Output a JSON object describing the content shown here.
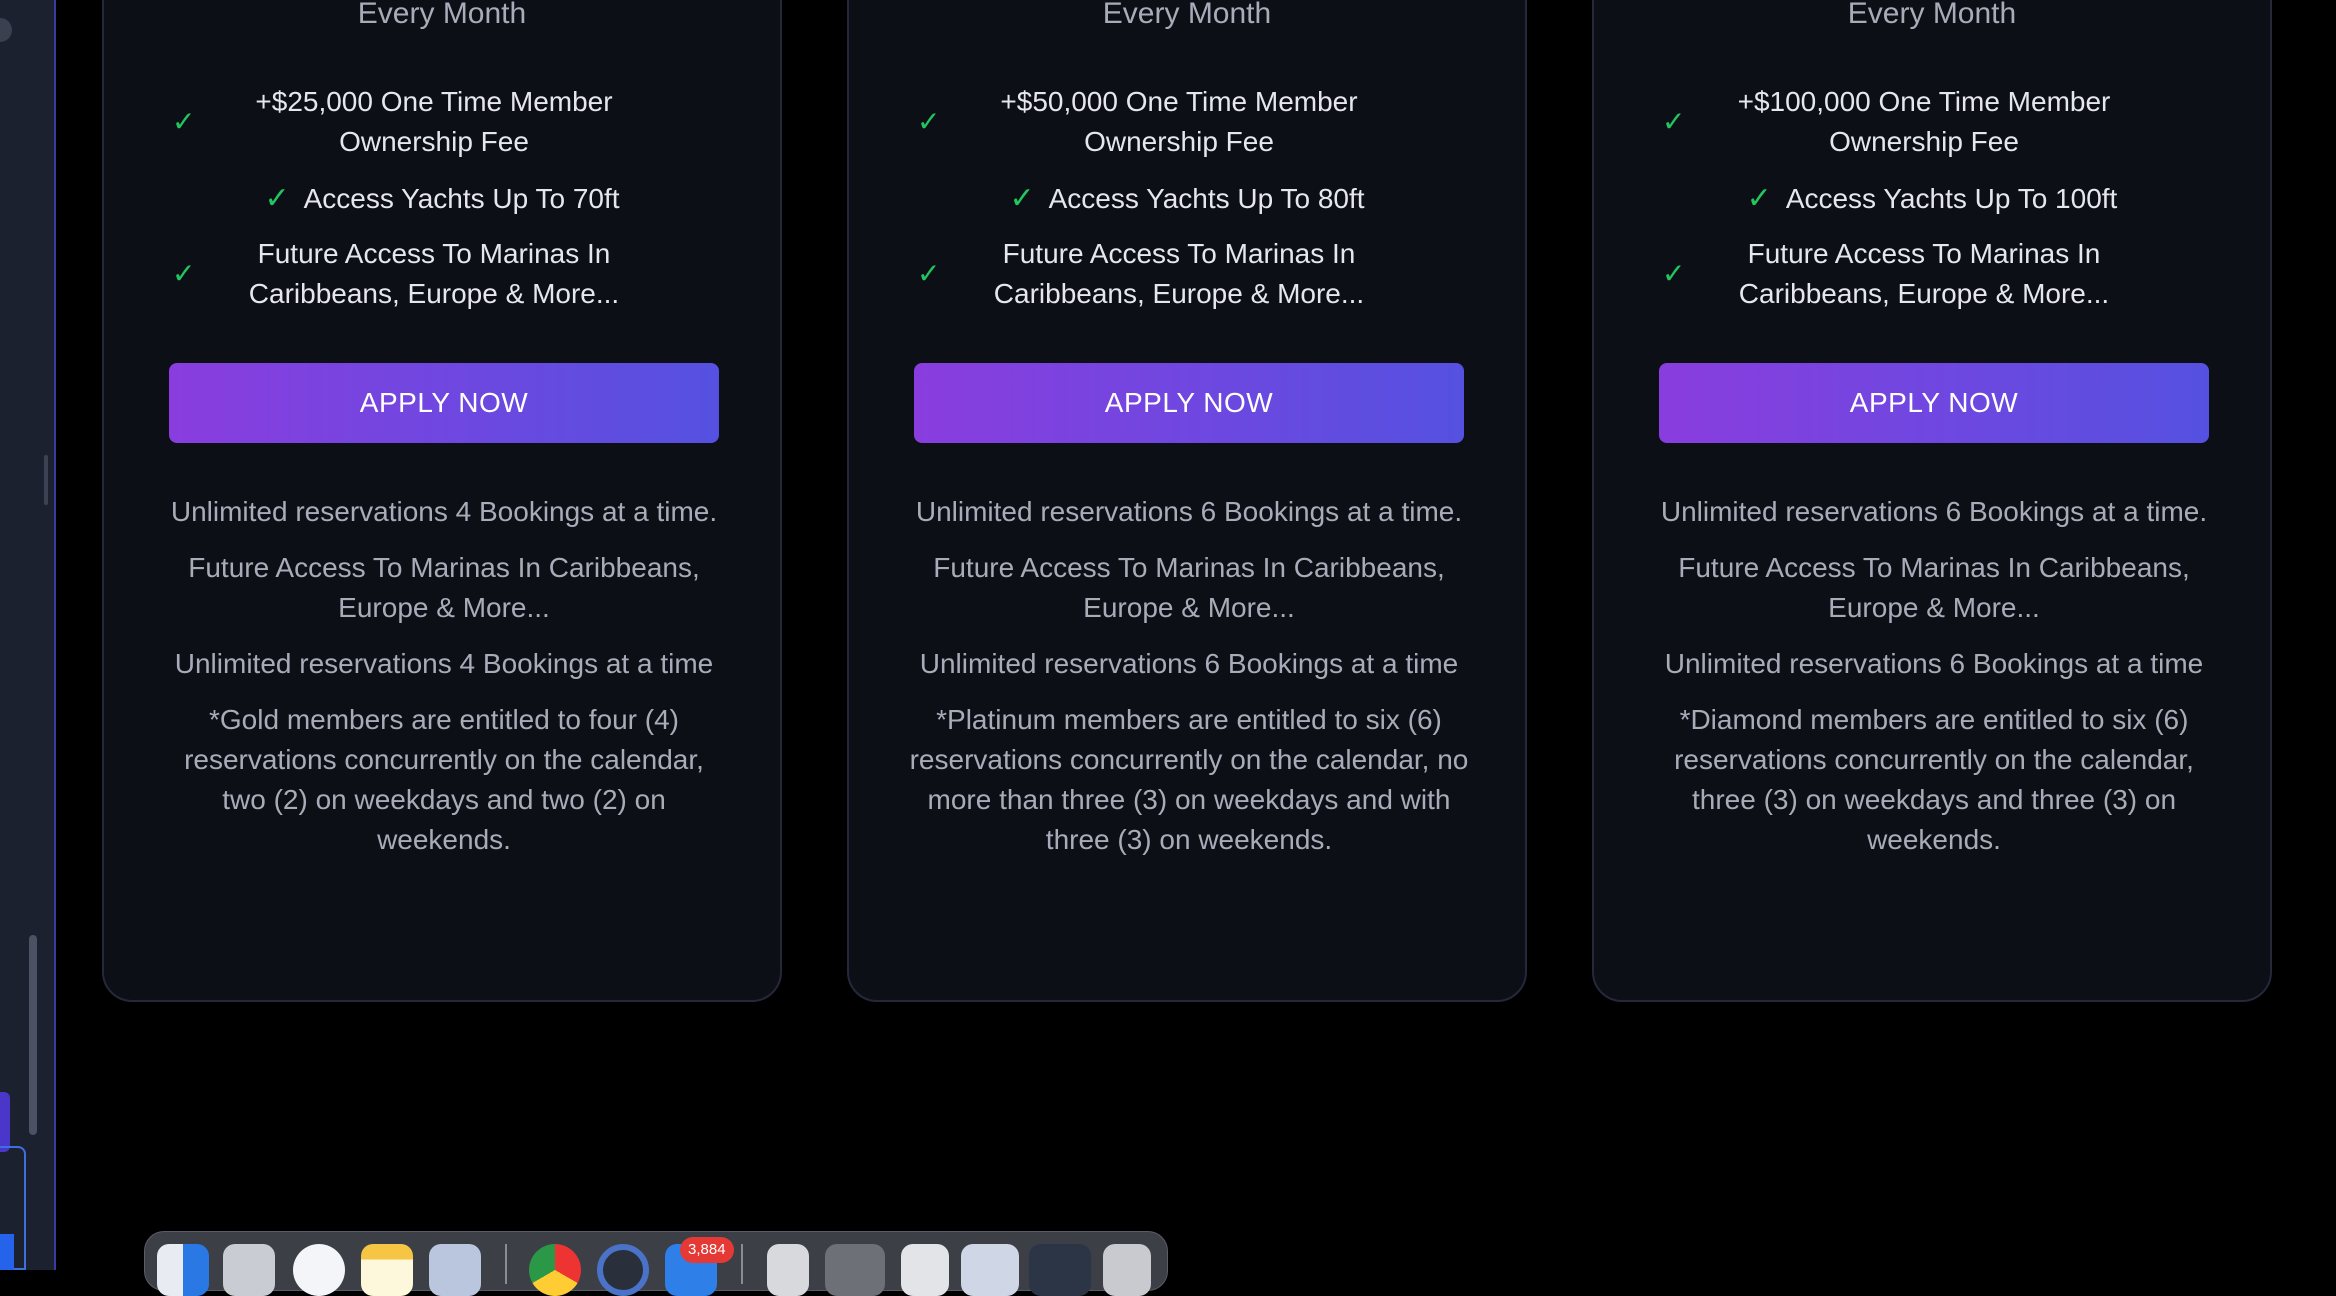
{
  "plans": [
    {
      "id": "gold",
      "period": "Every Month",
      "features": [
        "+$25,000 One Time Member Ownership Fee",
        "Access Yachts Up To 70ft",
        "Future Access To Marinas In Caribbeans, Europe & More..."
      ],
      "cta": "APPLY NOW",
      "notes": [
        "Unlimited reservations 4 Bookings at a time.",
        "Future Access To Marinas In Caribbeans, Europe & More...",
        "Unlimited reservations 4 Bookings at a time",
        "*Gold members are entitled to four (4) reservations concurrently on the calendar, two (2) on weekdays and two (2) on weekends."
      ]
    },
    {
      "id": "platinum",
      "period": "Every Month",
      "features": [
        "+$50,000 One Time Member Ownership Fee",
        "Access Yachts Up To 80ft",
        "Future Access To Marinas In Caribbeans, Europe & More..."
      ],
      "cta": "APPLY NOW",
      "notes": [
        "Unlimited reservations 6 Bookings at a time.",
        "Future Access To Marinas In Caribbeans, Europe & More...",
        "Unlimited reservations 6 Bookings at a time",
        "*Platinum members are entitled to six (6) reservations concurrently on the calendar, no more than three (3) on weekdays and with three (3) on weekends."
      ]
    },
    {
      "id": "diamond",
      "period": "Every Month",
      "features": [
        "+$100,000 One Time Member Ownership Fee",
        "Access Yachts Up To 100ft",
        "Future Access To Marinas In Caribbeans, Europe & More..."
      ],
      "cta": "APPLY NOW",
      "notes": [
        "Unlimited reservations 6 Bookings at a time.",
        "Future Access To Marinas In Caribbeans, Europe & More...",
        "Unlimited reservations 6 Bookings at a time",
        "*Diamond members are entitled to six (6) reservations concurrently on the calendar, three (3) on weekdays and three (3) on weekends."
      ]
    }
  ],
  "icons": {
    "check": "check-icon"
  },
  "colors": {
    "check": "#22c55e",
    "cta_start": "#8a3ddf",
    "cta_end": "#5551e0",
    "card_bg": "#0d0f17"
  },
  "dock": {
    "apps": [
      "Finder",
      "Launchpad",
      "Safari",
      "Notes",
      "Preview",
      "Chrome",
      "QuickTime",
      "Mail",
      "Document",
      "Screenshot",
      "Document",
      "Window",
      "Window",
      "Trash"
    ],
    "mail_badge": "3,884"
  }
}
